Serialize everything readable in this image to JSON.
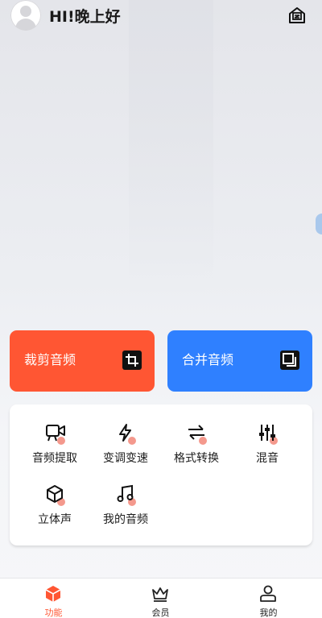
{
  "header": {
    "greeting": "HI!晚上好",
    "mail_icon": "mailbox-icon"
  },
  "cards": [
    {
      "label": "裁剪音频",
      "color": "#ff5633",
      "icon": "crop-icon"
    },
    {
      "label": "合并音频",
      "color": "#2f80ff",
      "icon": "copy-icon"
    }
  ],
  "tools": [
    {
      "label": "音频提取",
      "icon": "video-camera-icon"
    },
    {
      "label": "变调变速",
      "icon": "lightning-icon"
    },
    {
      "label": "格式转换",
      "icon": "swap-arrows-icon"
    },
    {
      "label": "混音",
      "icon": "mixer-sliders-icon"
    },
    {
      "label": "立体声",
      "icon": "cube-icon"
    },
    {
      "label": "我的音频",
      "icon": "music-note-icon"
    }
  ],
  "tabbar": [
    {
      "label": "功能",
      "icon": "cube-icon",
      "active": true,
      "active_color": "#ff5633"
    },
    {
      "label": "会员",
      "icon": "crown-icon",
      "active": false
    },
    {
      "label": "我的",
      "icon": "user-icon",
      "active": false
    }
  ]
}
